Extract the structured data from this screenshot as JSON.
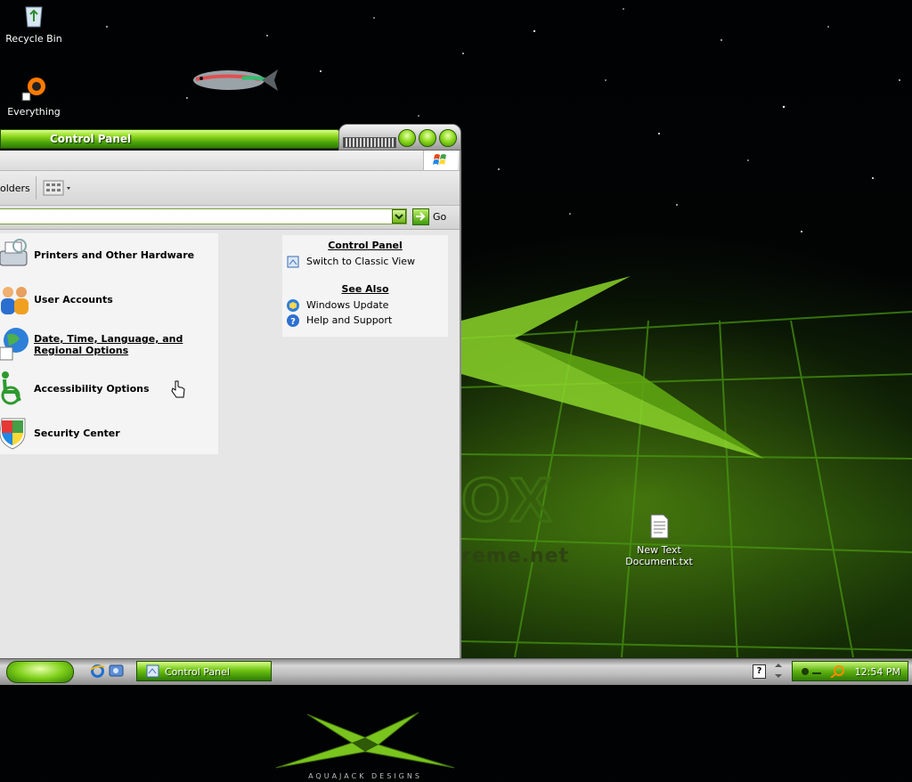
{
  "desktop": {
    "icons": [
      {
        "label": "Recycle Bin"
      },
      {
        "label": "Everything"
      },
      {
        "label": "New Text Document.txt"
      }
    ],
    "brand_text": "reme.net"
  },
  "window": {
    "title": "Control Panel",
    "toolbar": {
      "folders_label": "olders"
    },
    "address_bar": {
      "value": "",
      "go_label": "Go"
    },
    "categories": [
      {
        "label": "Printers and Other Hardware",
        "icon": "printer-icon"
      },
      {
        "label": "User Accounts",
        "icon": "users-icon"
      },
      {
        "label": "Date, Time, Language, and Regional Options",
        "icon": "globe-clock-icon"
      },
      {
        "label": "Accessibility Options",
        "icon": "wheelchair-icon"
      },
      {
        "label": "Security Center",
        "icon": "shield-icon"
      }
    ],
    "side_panel": {
      "control_panel_heading": "Control Panel",
      "switch_view_label": "Switch to Classic View",
      "see_also_heading": "See Also",
      "see_also_links": [
        {
          "label": "Windows Update",
          "icon": "windows-update-icon"
        },
        {
          "label": "Help and Support",
          "icon": "help-icon"
        }
      ]
    },
    "logo_caption": "AQUAJACK DESIGNS"
  },
  "taskbar": {
    "task_label": "Control Panel",
    "clock": "12:54 PM",
    "help_glyph": "?"
  },
  "colors": {
    "accent_green": "#6fc412",
    "dark_green": "#2c7a05"
  }
}
